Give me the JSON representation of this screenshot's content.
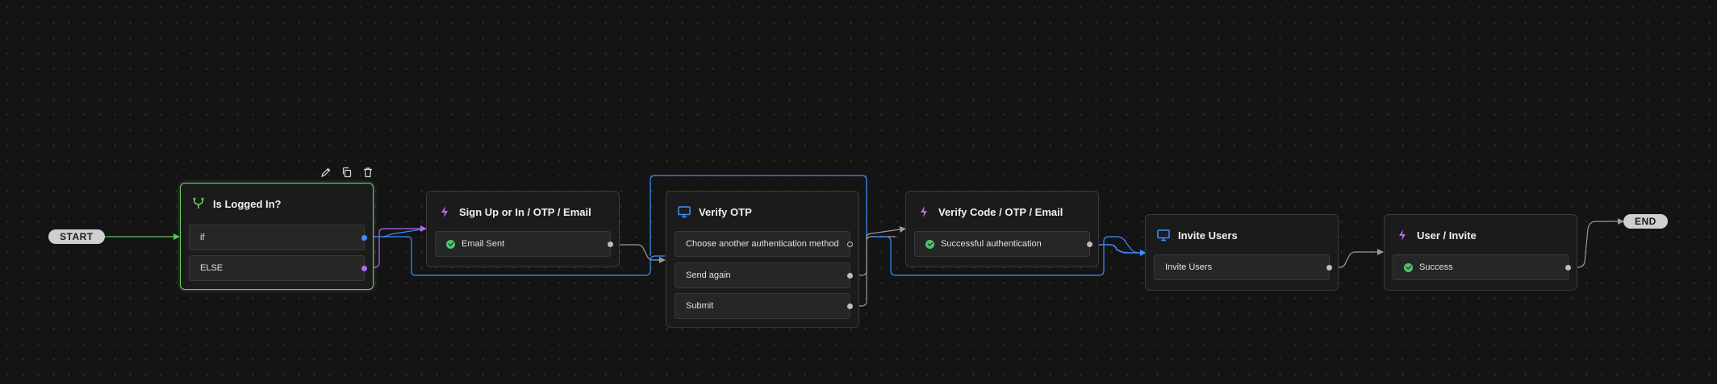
{
  "start_label": "START",
  "end_label": "END",
  "colors": {
    "selected_border": "#6fd56b",
    "flow_edge": "#3d8fff",
    "purple": "#b26af2",
    "gray_edge": "#9a9a9a",
    "start_edge": "#5fbf5a"
  },
  "toolbar": {
    "edit_icon": "pencil-icon",
    "copy_icon": "copy-icon",
    "delete_icon": "trash-icon"
  },
  "nodes": {
    "is_logged_in": {
      "icon": "branch-icon",
      "title": "Is Logged In?",
      "rows": [
        {
          "label": "if"
        },
        {
          "label": "ELSE"
        }
      ]
    },
    "sign_up": {
      "icon": "lightning-icon",
      "title": "Sign Up or In / OTP / Email",
      "rows": [
        {
          "label": "Email Sent"
        }
      ]
    },
    "verify_otp": {
      "icon": "screen-icon",
      "title": "Verify OTP",
      "rows": [
        {
          "label": "Choose another authentication method"
        },
        {
          "label": "Send again"
        },
        {
          "label": "Submit"
        }
      ]
    },
    "verify_code": {
      "icon": "lightning-icon",
      "title": "Verify Code / OTP / Email",
      "rows": [
        {
          "label": "Successful authentication"
        }
      ]
    },
    "invite_users": {
      "icon": "screen-icon",
      "title": "Invite Users",
      "rows": [
        {
          "label": "Invite Users"
        }
      ]
    },
    "user_invite": {
      "icon": "lightning-icon",
      "title": "User / Invite",
      "rows": [
        {
          "label": "Success"
        }
      ]
    }
  }
}
